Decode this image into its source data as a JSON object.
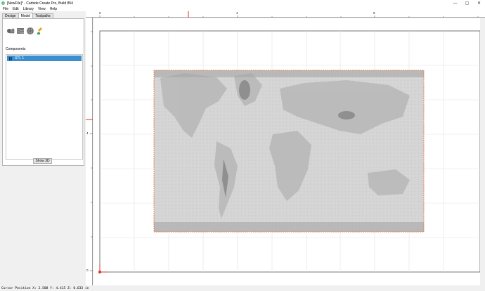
{
  "window": {
    "title": "[NewFile]* - Carbide Create Pro, Build 854",
    "minimize_glyph": "—",
    "maximize_glyph": "▢",
    "close_glyph": "✕"
  },
  "menu": [
    "File",
    "Edit",
    "Library",
    "View",
    "Help"
  ],
  "tabs": [
    {
      "label": "Design",
      "active": false
    },
    {
      "label": "Model",
      "active": true
    },
    {
      "label": "Toolpaths",
      "active": false
    }
  ],
  "tools": [
    "import-stl-icon",
    "texture-icon",
    "sphere-icon",
    "paint-icon"
  ],
  "components": {
    "label": "Components",
    "items": [
      {
        "label": "STL 1",
        "selected": true
      }
    ]
  },
  "show3d_label": "Show 3D",
  "rulers": {
    "top_labels": [
      "0",
      "4",
      "8"
    ],
    "left_labels": [
      "4",
      "0"
    ]
  },
  "status": {
    "cursor": "Cursor Position X: 2.508 Y: 4.415 Z: 0.633 in"
  },
  "colors": {
    "selection_blue": "#3b8fd0",
    "marker_red": "#e03020",
    "bounding_box_orange": "#f07030"
  }
}
